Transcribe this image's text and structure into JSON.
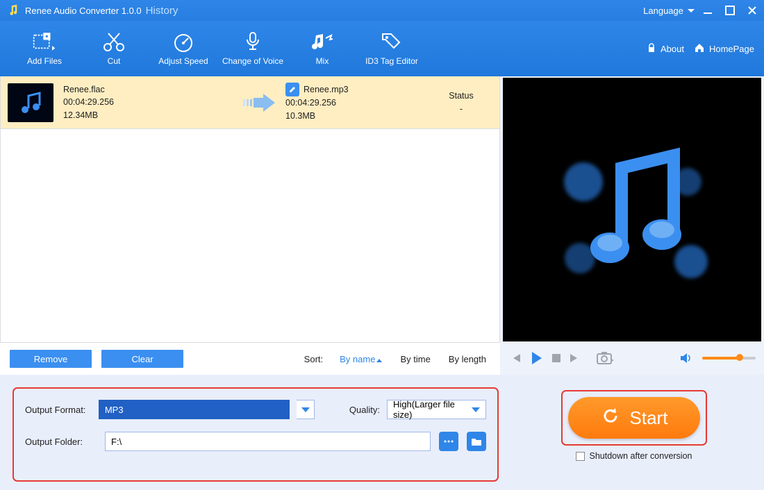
{
  "title": "Renee Audio Converter 1.0.0",
  "history": "History",
  "language_label": "Language",
  "toolbar": {
    "add_files": "Add Files",
    "cut": "Cut",
    "adjust_speed": "Adjust Speed",
    "change_voice": "Change of Voice",
    "mix": "Mix",
    "id3": "ID3 Tag Editor"
  },
  "about": "About",
  "homepage": "HomePage",
  "file": {
    "src_name": "Renee.flac",
    "src_duration": "00:04:29.256",
    "src_size": "12.34MB",
    "dst_name": "Renee.mp3",
    "dst_duration": "00:04:29.256",
    "dst_size": "10.3MB",
    "status_header": "Status",
    "status_value": "-"
  },
  "buttons": {
    "remove": "Remove",
    "clear": "Clear"
  },
  "sort": {
    "label": "Sort:",
    "by_name": "By name",
    "by_time": "By time",
    "by_length": "By length"
  },
  "output": {
    "format_label": "Output Format:",
    "format_value": "MP3",
    "quality_label": "Quality:",
    "quality_value": "High(Larger file size)",
    "folder_label": "Output Folder:",
    "folder_value": "F:\\"
  },
  "start": "Start",
  "shutdown": "Shutdown after conversion"
}
